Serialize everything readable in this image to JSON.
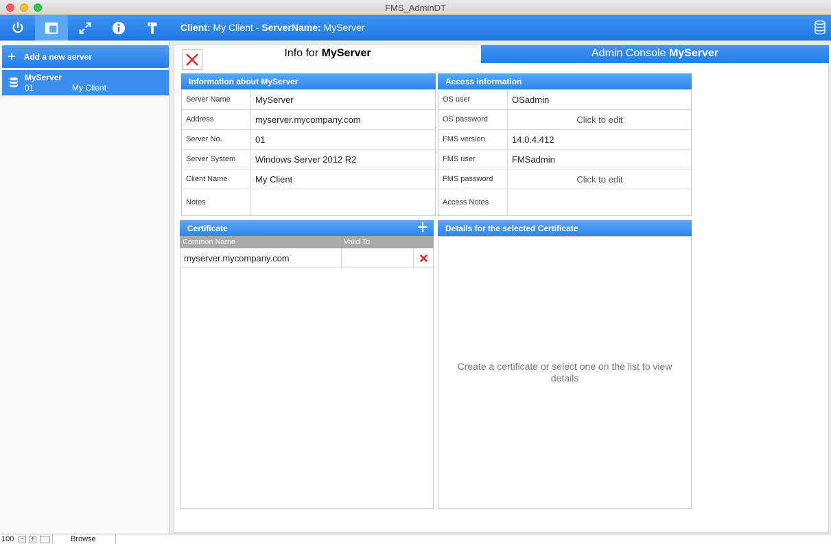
{
  "window": {
    "title": "FMS_AdminDT"
  },
  "toolbar": {
    "buttons": [
      {
        "icon": "power-icon"
      },
      {
        "icon": "layout-icon",
        "active": true
      },
      {
        "icon": "expand-icon"
      },
      {
        "icon": "info-icon"
      },
      {
        "icon": "tools-icon"
      }
    ],
    "client_label": "Client:",
    "client_value": " My Client - ",
    "server_label": "ServerName:",
    "server_value": " MyServer"
  },
  "sidebar": {
    "add_label": "Add a new server",
    "add_plus": "+",
    "servers": [
      {
        "name": "MyServer",
        "number": "01",
        "client": "My Client"
      }
    ]
  },
  "tabs": {
    "info_prefix": "Info for ",
    "info_server": "MyServer",
    "admin_prefix": "Admin Console ",
    "admin_server": "MyServer"
  },
  "info_panel": {
    "title": "Information about MyServer",
    "rows": [
      {
        "label": "Server Name",
        "value": "MyServer"
      },
      {
        "label": "Address",
        "value": "myserver.mycompany.com"
      },
      {
        "label": "Server No.",
        "value": "01"
      },
      {
        "label": "Server System",
        "value": "Windows Server 2012 R2"
      },
      {
        "label": "Client Name",
        "value": "My Client"
      },
      {
        "label": "Notes",
        "value": ""
      }
    ]
  },
  "access_panel": {
    "title": "Access information",
    "rows": [
      {
        "label": "OS user",
        "value": "OSadmin"
      },
      {
        "label": "OS password",
        "value": "Click to edit"
      },
      {
        "label": "FMS version",
        "value": "14.0.4.412"
      },
      {
        "label": "FMS user",
        "value": "FMSadmin"
      },
      {
        "label": "FMS password",
        "value": "Click to edit"
      },
      {
        "label": "Access Notes",
        "value": ""
      }
    ]
  },
  "certificate": {
    "title": "Certificate",
    "col_common_name": "Common Name",
    "col_valid_to": "Valid To",
    "rows": [
      {
        "common_name": "myserver.mycompany.com",
        "valid_to": ""
      }
    ]
  },
  "details": {
    "title": "Details for the selected Certificate",
    "placeholder": "Create a certificate or select one on the list to view details"
  },
  "statusbar": {
    "zoom": "100",
    "mode": "Browse"
  },
  "colors": {
    "accent": "#2580e6",
    "delete": "#e0242a"
  }
}
